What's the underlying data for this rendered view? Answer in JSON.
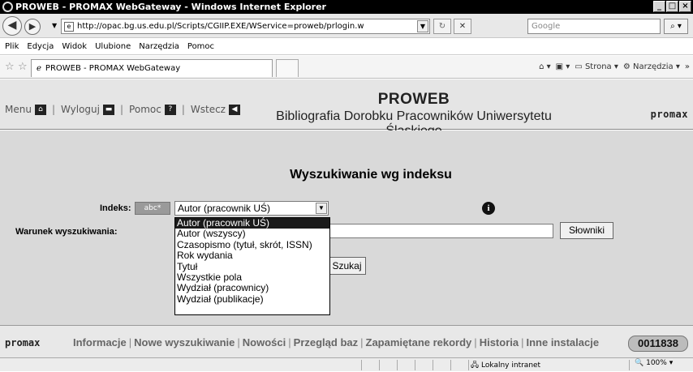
{
  "window": {
    "title": "PROWEB - PROMAX WebGateway - Windows Internet Explorer"
  },
  "address": {
    "url": "http://opac.bg.us.edu.pl/Scripts/CGIIP.EXE/WService=proweb/prlogin.w",
    "search_placeholder": "Google"
  },
  "menu": [
    "Plik",
    "Edycja",
    "Widok",
    "Ulubione",
    "Narzędzia",
    "Pomoc"
  ],
  "tab": {
    "label": "PROWEB - PROMAX WebGateway"
  },
  "commandbar": {
    "page": "Strona",
    "tools": "Narzędzia"
  },
  "header": {
    "nav": {
      "menu": "Menu",
      "logout": "Wyloguj",
      "help": "Pomoc",
      "back": "Wstecz"
    },
    "title": "PROWEB",
    "subtitle": "Bibliografia Dorobku Pracowników Uniwersytetu Śląskiego",
    "logo": "promax"
  },
  "form": {
    "heading": "Wyszukiwanie wg indeksu",
    "index_label": "Indeks:",
    "abc_label": "abc*",
    "selected_index": "Autor (pracownik UŚ)",
    "condition_label": "Warunek wyszukiwania:",
    "condition_value": "",
    "dictionaries_button": "Słowniki",
    "search_button": "Szukaj",
    "options": [
      "Autor (pracownik UŚ)",
      "Autor (wszyscy)",
      "Czasopismo (tytuł, skrót, ISSN)",
      "Rok wydania",
      "Tytuł",
      "Wszystkie pola",
      "Wydział (pracownicy)",
      "Wydział (publikacje)"
    ]
  },
  "footer": {
    "logo": "promax",
    "links": [
      "Informacje",
      "Nowe wyszukiwanie",
      "Nowości",
      "Przegląd baz",
      "Zapamiętane rekordy",
      "Historia",
      "Inne instalacje"
    ],
    "counter": "0011838"
  },
  "status": {
    "zone": "Lokalny intranet",
    "zoom": "100%"
  }
}
